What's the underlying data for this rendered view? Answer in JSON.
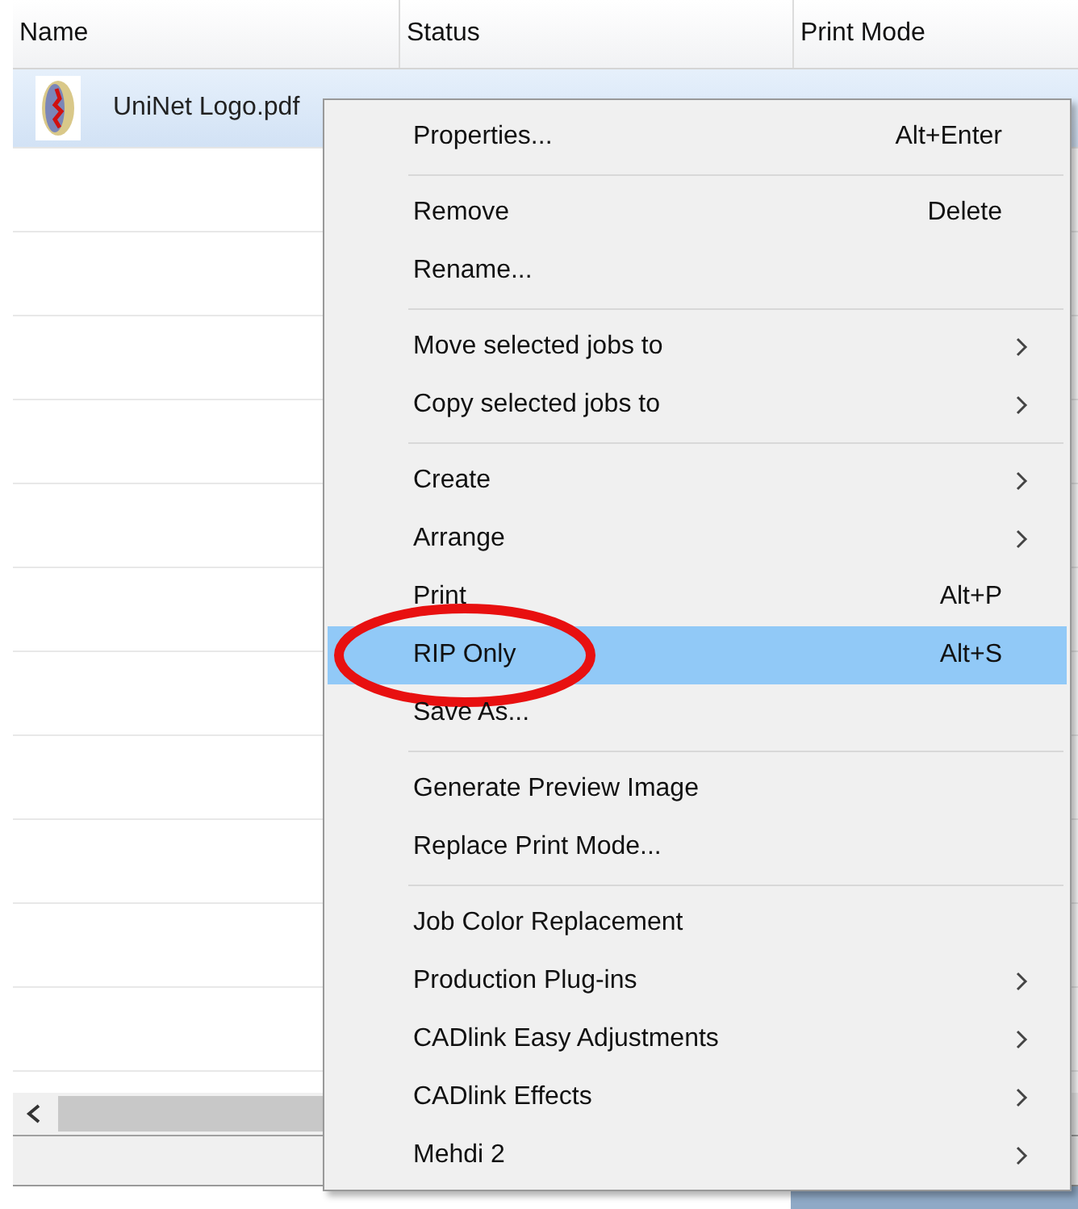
{
  "table": {
    "columns": [
      "Name",
      "Status",
      "Print Mode"
    ],
    "rows": [
      {
        "name": "UniNet Logo.pdf",
        "selected": true
      }
    ]
  },
  "context_menu": {
    "items": [
      {
        "kind": "item",
        "label": "Properties...",
        "shortcut": "Alt+Enter",
        "submenu": false,
        "selected": false,
        "circled": false
      },
      {
        "kind": "separator"
      },
      {
        "kind": "item",
        "label": "Remove",
        "shortcut": "Delete",
        "submenu": false,
        "selected": false,
        "circled": false
      },
      {
        "kind": "item",
        "label": "Rename...",
        "submenu": false,
        "selected": false,
        "circled": false
      },
      {
        "kind": "separator"
      },
      {
        "kind": "item",
        "label": "Move selected jobs to",
        "submenu": true,
        "selected": false,
        "circled": false
      },
      {
        "kind": "item",
        "label": "Copy selected jobs to",
        "submenu": true,
        "selected": false,
        "circled": false
      },
      {
        "kind": "separator"
      },
      {
        "kind": "item",
        "label": "Create",
        "submenu": true,
        "selected": false,
        "circled": false
      },
      {
        "kind": "item",
        "label": "Arrange",
        "submenu": true,
        "selected": false,
        "circled": false
      },
      {
        "kind": "item",
        "label": "Print",
        "shortcut": "Alt+P",
        "submenu": false,
        "selected": false,
        "circled": false
      },
      {
        "kind": "item",
        "label": "RIP Only",
        "shortcut": "Alt+S",
        "submenu": false,
        "selected": true,
        "circled": true
      },
      {
        "kind": "item",
        "label": "Save As...",
        "submenu": false,
        "selected": false,
        "circled": false
      },
      {
        "kind": "separator"
      },
      {
        "kind": "item",
        "label": "Generate Preview Image",
        "submenu": false,
        "selected": false,
        "circled": false
      },
      {
        "kind": "item",
        "label": "Replace Print Mode...",
        "submenu": false,
        "selected": false,
        "circled": false
      },
      {
        "kind": "separator"
      },
      {
        "kind": "item",
        "label": "Job Color Replacement",
        "submenu": false,
        "selected": false,
        "circled": false
      },
      {
        "kind": "item",
        "label": "Production Plug-ins",
        "submenu": true,
        "selected": false,
        "circled": false
      },
      {
        "kind": "item",
        "label": "CADlink Easy Adjustments",
        "submenu": true,
        "selected": false,
        "circled": false
      },
      {
        "kind": "item",
        "label": "CADlink Effects",
        "submenu": true,
        "selected": false,
        "circled": false
      },
      {
        "kind": "item",
        "label": "Mehdi 2",
        "submenu": true,
        "selected": false,
        "circled": false
      }
    ]
  }
}
